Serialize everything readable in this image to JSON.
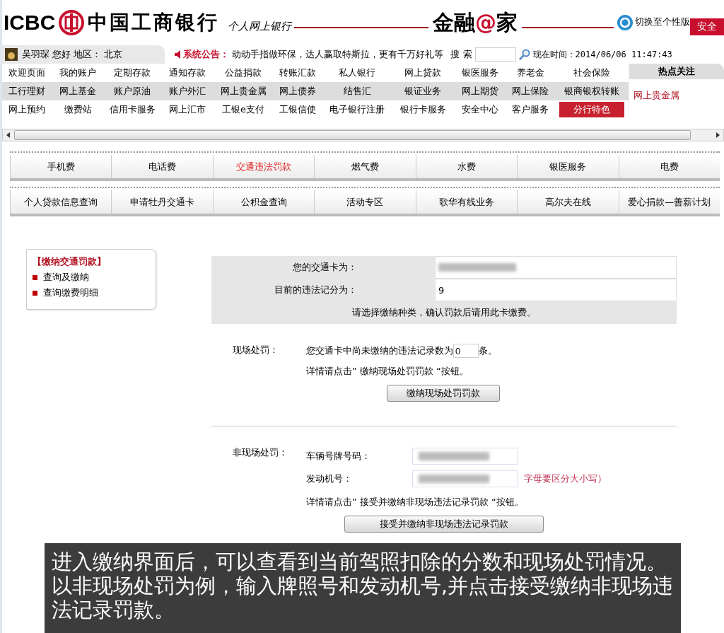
{
  "header": {
    "bank_name_en": "ICBC",
    "bank_name": "中国工商银行",
    "subtitle": "个人网上银行",
    "slogan": {
      "before": "金融",
      "at": "@",
      "after": "家"
    },
    "switch_link": "切换至个性版",
    "logout_button": "安全"
  },
  "user_bar": {
    "user": "吴羽琛",
    "greeting": "您好",
    "region_label": "地区：",
    "region": "北京",
    "notice_label": "系统公告：",
    "notice": "动动手指做环保，达人赢取特斯拉，更有千万好礼等",
    "search_label": "搜 索",
    "time_label": "现在时间：",
    "time": "2014/06/06 11:47:43"
  },
  "nav_rows": [
    [
      {
        "label": "欢迎页面",
        "selected": false
      },
      {
        "label": "我的账户",
        "selected": false
      },
      {
        "label": "定期存款",
        "selected": false
      },
      {
        "label": "通知存款",
        "selected": false
      },
      {
        "label": "公益捐款",
        "selected": false
      },
      {
        "label": "转账汇款",
        "selected": false
      },
      {
        "label": "私人银行",
        "selected": false
      },
      {
        "label": "网上贷款",
        "selected": false
      },
      {
        "label": "银医服务",
        "selected": false
      },
      {
        "label": "养老金",
        "selected": false
      },
      {
        "label": "社会保险",
        "selected": false
      }
    ],
    [
      {
        "label": "工行理财",
        "selected": false
      },
      {
        "label": "网上基金",
        "selected": false
      },
      {
        "label": "账户原油",
        "selected": false
      },
      {
        "label": "账户外汇",
        "selected": false
      },
      {
        "label": "网上贵金属",
        "selected": false
      },
      {
        "label": "网上债券",
        "selected": false
      },
      {
        "label": "结售汇",
        "selected": false
      },
      {
        "label": "银证业务",
        "selected": false
      },
      {
        "label": "网上期货",
        "selected": false
      },
      {
        "label": "网上保险",
        "selected": false
      },
      {
        "label": "银商银权转账",
        "selected": false
      }
    ],
    [
      {
        "label": "网上预约",
        "selected": false
      },
      {
        "label": "缴费站",
        "selected": false
      },
      {
        "label": "信用卡服务",
        "selected": false
      },
      {
        "label": "网上汇市",
        "selected": false
      },
      {
        "label": "工银e支付",
        "selected": false
      },
      {
        "label": "工银信使",
        "selected": false
      },
      {
        "label": "电子银行注册",
        "selected": false
      },
      {
        "label": "银行卡服务",
        "selected": false
      },
      {
        "label": "安全中心",
        "selected": false
      },
      {
        "label": "客户服务",
        "selected": false
      },
      {
        "label": "分行特色",
        "selected": true
      }
    ]
  ],
  "hot_panel": {
    "title": "热点关注",
    "items": [
      "网上贵金属"
    ]
  },
  "fee_tabs": [
    [
      {
        "label": "手机费",
        "selected": false
      },
      {
        "label": "电话费",
        "selected": false
      },
      {
        "label": "交通违法罚款",
        "selected": true
      },
      {
        "label": "燃气费",
        "selected": false
      },
      {
        "label": "水费",
        "selected": false
      },
      {
        "label": "银医服务",
        "selected": false
      },
      {
        "label": "电费",
        "selected": false
      }
    ],
    [
      {
        "label": "个人贷款信息查询",
        "selected": false
      },
      {
        "label": "申请牡丹交通卡",
        "selected": false
      },
      {
        "label": "公积金查询",
        "selected": false
      },
      {
        "label": "活动专区",
        "selected": false
      },
      {
        "label": "歌华有线业务",
        "selected": false
      },
      {
        "label": "高尔夫在线",
        "selected": false
      },
      {
        "label": "爱心捐款—善薪计划",
        "selected": false
      }
    ]
  ],
  "side_menu": {
    "title": "【缴纳交通罚款】",
    "items": [
      "查询及缴纳",
      "查询缴费明细"
    ]
  },
  "card_info": {
    "rows": [
      {
        "label": "您的交通卡为：",
        "blurred": true
      },
      {
        "label": "目前的违法记分为：",
        "blurred": false,
        "value": "9"
      }
    ],
    "note": "请选择缴纳种类，确认罚款后请用此卡缴费。"
  },
  "onsite": {
    "label": "现场处罚：",
    "count_prefix": "您交通卡中尚未缴纳的违法记录数为",
    "count": "0",
    "count_suffix": "条。",
    "hint": "详情请点击” 缴纳现场处罚罚款 “按钮。",
    "button": "缴纳现场处罚罚款"
  },
  "offsite": {
    "label": "非现场处罚：",
    "fields": [
      {
        "label": "车辆号牌号码：",
        "blurred": true
      },
      {
        "label": "发动机号：",
        "blurred": true,
        "note": "字母要区分大小写）"
      }
    ],
    "hint": "详情请点击” 接受并缴纳非现场违法记录罚款 “按钮。",
    "button": "接受并缴纳非现场违法记录罚款"
  },
  "caption": "进入缴纳界面后，可以查看到当前驾照扣除的分数和现场处罚情况。以非现场处罚为例，输入牌照号和发动机号,并点击接受缴纳非现场违法记录罚款。"
}
